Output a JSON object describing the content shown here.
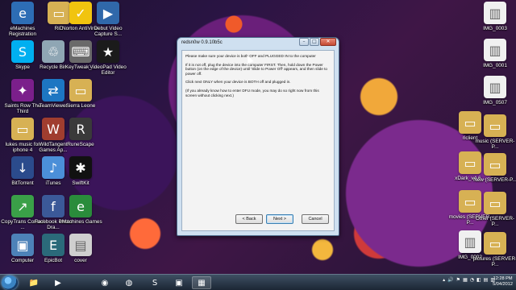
{
  "desktop": {
    "left_icons": [
      {
        "label": "eMachines Registration",
        "icon": "emachines-icon",
        "color": "#2d6db5",
        "glyph": "e"
      },
      {
        "label": "RiD",
        "icon": "folder-icon",
        "color": "#d7b154",
        "glyph": "▭"
      },
      {
        "label": "Norton AntiVirus",
        "icon": "norton-icon",
        "color": "#f1c40f",
        "glyph": "✓"
      },
      {
        "label": "Debut Video Capture S...",
        "icon": "debut-video-icon",
        "color": "#3068aa",
        "glyph": "▶"
      },
      {
        "label": "Skype",
        "icon": "skype-icon",
        "color": "#00aff0",
        "glyph": "S"
      },
      {
        "label": "Recycle Bin",
        "icon": "recycle-bin-icon",
        "color": "#8fa6b4",
        "glyph": "♲"
      },
      {
        "label": "KeyTweak_...",
        "icon": "keytweak-icon",
        "color": "#6a6a6a",
        "glyph": "⌨"
      },
      {
        "label": "VideoPad Video Editor",
        "icon": "videopad-icon",
        "color": "#1b1b1b",
        "glyph": "★"
      },
      {
        "label": "Saints Row The Third",
        "icon": "saints-row-icon",
        "color": "#7b1f8b",
        "glyph": "✦"
      },
      {
        "label": "TeamViewer",
        "icon": "teamviewer-icon",
        "color": "#1d76c2",
        "glyph": "⇄"
      },
      {
        "label": "Sierra Leone",
        "icon": "folder-icon",
        "color": "#d7b154",
        "glyph": "▭"
      },
      {
        "label": "lukes music for iphone 4",
        "icon": "folder-icon",
        "color": "#d7b154",
        "glyph": "▭"
      },
      {
        "label": "WildTangent Games Ap...",
        "icon": "wildtangent-icon",
        "color": "#a03d2f",
        "glyph": "W"
      },
      {
        "label": "RuneScape",
        "icon": "runescape-icon",
        "color": "#3a3a3a",
        "glyph": "R"
      },
      {
        "label": "BitTorrent",
        "icon": "bittorrent-icon",
        "color": "#2b4b8c",
        "glyph": "↓"
      },
      {
        "label": "iTunes",
        "icon": "itunes-icon",
        "color": "#4b8fd8",
        "glyph": "♪"
      },
      {
        "label": "SwiftKit",
        "icon": "swiftkit-icon",
        "color": "#111111",
        "glyph": "✱"
      },
      {
        "label": "CopyTrans Control ...",
        "icon": "copytrans-icon",
        "color": "#3aa048",
        "glyph": "↗"
      },
      {
        "label": "Facebook Photo Dra...",
        "icon": "facebook-photo-icon",
        "color": "#3b5998",
        "glyph": "f"
      },
      {
        "label": "eMachines Games",
        "icon": "emachines-games-icon",
        "color": "#2a8c3b",
        "glyph": "e"
      },
      {
        "label": "Computer",
        "icon": "computer-icon",
        "color": "#4d82b8",
        "glyph": "▣"
      },
      {
        "label": "EpicBot",
        "icon": "epicbot-icon",
        "color": "#2b6a7a",
        "glyph": "E"
      },
      {
        "label": "cover",
        "icon": "image-icon",
        "color": "#cfcfcf",
        "glyph": "▤"
      }
    ],
    "right_icons": [
      {
        "label": "IMG_0003",
        "icon": "image-file-icon",
        "color": "#f0f0f0",
        "glyph": "▥"
      },
      {
        "label": "IMG_0001",
        "icon": "image-file-icon",
        "color": "#f0f0f0",
        "glyph": "▥"
      },
      {
        "label": "IMG_0507",
        "icon": "image-file-icon",
        "color": "#f0f0f0",
        "glyph": "▥"
      },
      {
        "label": "riclient",
        "icon": "folder-icon",
        "color": "#d7b154",
        "glyph": "▭"
      },
      {
        "label": "music (SERVER-P...",
        "icon": "network-folder-icon",
        "color": "#d7b154",
        "glyph": "▭"
      },
      {
        "label": "xDark_v4.6...",
        "icon": "folder-icon",
        "color": "#d7b154",
        "glyph": "▭"
      },
      {
        "label": "New (SERVER-P...",
        "icon": "network-folder-icon",
        "color": "#d7b154",
        "glyph": "▭"
      },
      {
        "label": "movies (SERVER-P...",
        "icon": "network-folder-icon",
        "color": "#d7b154",
        "glyph": "▭"
      },
      {
        "label": "Other (SERVER-P...",
        "icon": "network-folder-icon",
        "color": "#d7b154",
        "glyph": "▭"
      },
      {
        "label": "IMG_0002",
        "icon": "image-file-icon",
        "color": "#f0f0f0",
        "glyph": "▥"
      },
      {
        "label": "pictures (SERVER-P...",
        "icon": "network-folder-icon",
        "color": "#d7b154",
        "glyph": "▭"
      }
    ]
  },
  "dialog": {
    "title": "redsn0w 0.9.10b5c",
    "paragraphs": [
      "Please make sure your device is both OFF and PLUGGED IN to the computer",
      "If it is not off, plug the device into the computer FIRST. Then, hold down the Power button (on the edge of the device) until 'Slide to Power Off' appears, and then slide to power off.",
      "Click next ONLY when your device is BOTH off and plugged in.",
      "(If you already know how to enter DFU mode, you may do so right now from this screen without clicking next.)"
    ],
    "back_label": "< Back",
    "next_label": "Next >",
    "cancel_label": "Cancel",
    "minimize_label": "–",
    "maximize_label": "□",
    "close_label": "✕"
  },
  "taskbar": {
    "items": [
      {
        "icon": "explorer-icon",
        "glyph": "📁"
      },
      {
        "icon": "media-player-icon",
        "glyph": "▶"
      },
      {
        "icon": "chrome-icon",
        "glyph": "◉"
      },
      {
        "icon": "tor-icon",
        "glyph": "◍"
      },
      {
        "icon": "skype-icon",
        "glyph": "S"
      },
      {
        "icon": "save-icon",
        "glyph": "▣"
      },
      {
        "icon": "redsn0w-app-icon",
        "glyph": "▦"
      }
    ],
    "time": "12:28 PM",
    "date": "5/04/2012",
    "tray_icons": [
      "▴",
      "🔊",
      "⚑",
      "▦",
      "◔",
      "◧",
      "▤",
      "▥"
    ]
  }
}
